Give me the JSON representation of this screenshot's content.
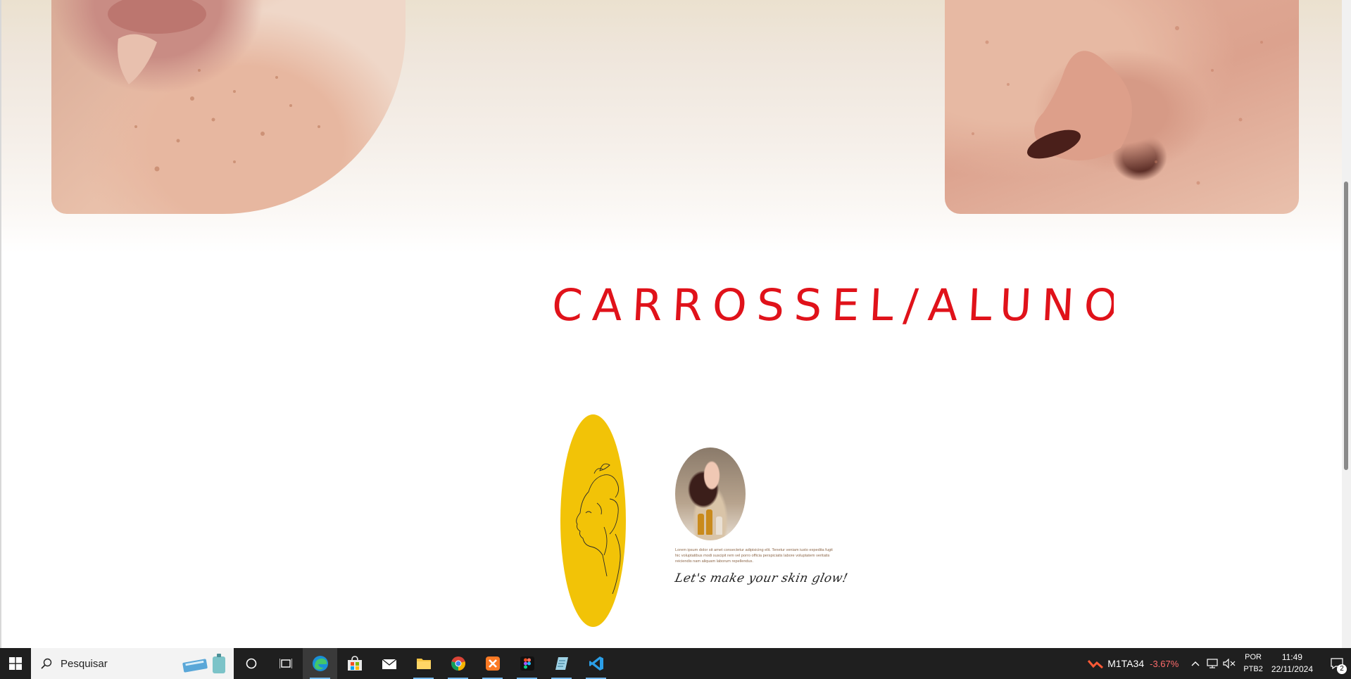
{
  "page": {
    "annotation_text": "CARROSSEL/ALUNO",
    "bio_text": "Lorem ipsum dolor sit amet consectetur adipisicing elit. Tenetur veniam iusto expedita fugit hic voluptatibus modi suscipit rem vel porro officia perspiciatis labore voluptatem veritatis reiciendis nam aliquam laborum repellendus.",
    "signature": "Let's make your skin glow!",
    "accent_yellow": "#f2c307",
    "annotation_color": "#e0121a"
  },
  "taskbar": {
    "search_placeholder": "Pesquisar",
    "apps": [
      {
        "name": "cortana",
        "icon": "circle-icon"
      },
      {
        "name": "task-view",
        "icon": "task-view-icon"
      },
      {
        "name": "edge",
        "icon": "edge-icon"
      },
      {
        "name": "microsoft-store",
        "icon": "store-icon"
      },
      {
        "name": "mail",
        "icon": "mail-icon"
      },
      {
        "name": "file-explorer",
        "icon": "folder-icon"
      },
      {
        "name": "chrome",
        "icon": "chrome-icon"
      },
      {
        "name": "xampp",
        "icon": "xampp-icon"
      },
      {
        "name": "figma",
        "icon": "figma-icon"
      },
      {
        "name": "notepad",
        "icon": "notepad-icon"
      },
      {
        "name": "vscode",
        "icon": "vscode-icon"
      }
    ],
    "stock": {
      "symbol": "M1TA34",
      "change": "-3.67%"
    },
    "language": {
      "line1": "POR",
      "line2": "PTB2"
    },
    "clock": {
      "time": "11:49",
      "date": "22/11/2024"
    },
    "notifications": "2"
  }
}
